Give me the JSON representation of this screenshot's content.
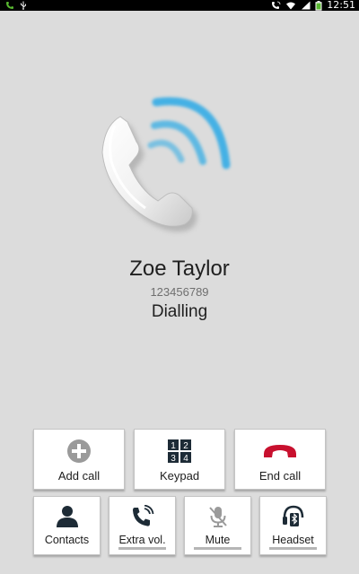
{
  "status_bar": {
    "time": "12:51",
    "icons": [
      "call-icon",
      "usb-icon",
      "call-active-icon",
      "wifi-icon",
      "signal-icon",
      "battery-icon"
    ]
  },
  "caller": {
    "name": "Zoe Taylor",
    "number": "123456789",
    "status": "Dialling"
  },
  "actions": {
    "add_call": "Add call",
    "keypad": "Keypad",
    "keypad_digits": [
      "1",
      "2",
      "3",
      "4"
    ],
    "end_call": "End call",
    "contacts": "Contacts",
    "extra_vol": "Extra vol.",
    "mute": "Mute",
    "headset": "Headset"
  },
  "colors": {
    "end_call_red": "#c8102e",
    "wave_blue": "#29a9e6",
    "icon_dark": "#1d2b36",
    "status_green": "#59b831"
  }
}
